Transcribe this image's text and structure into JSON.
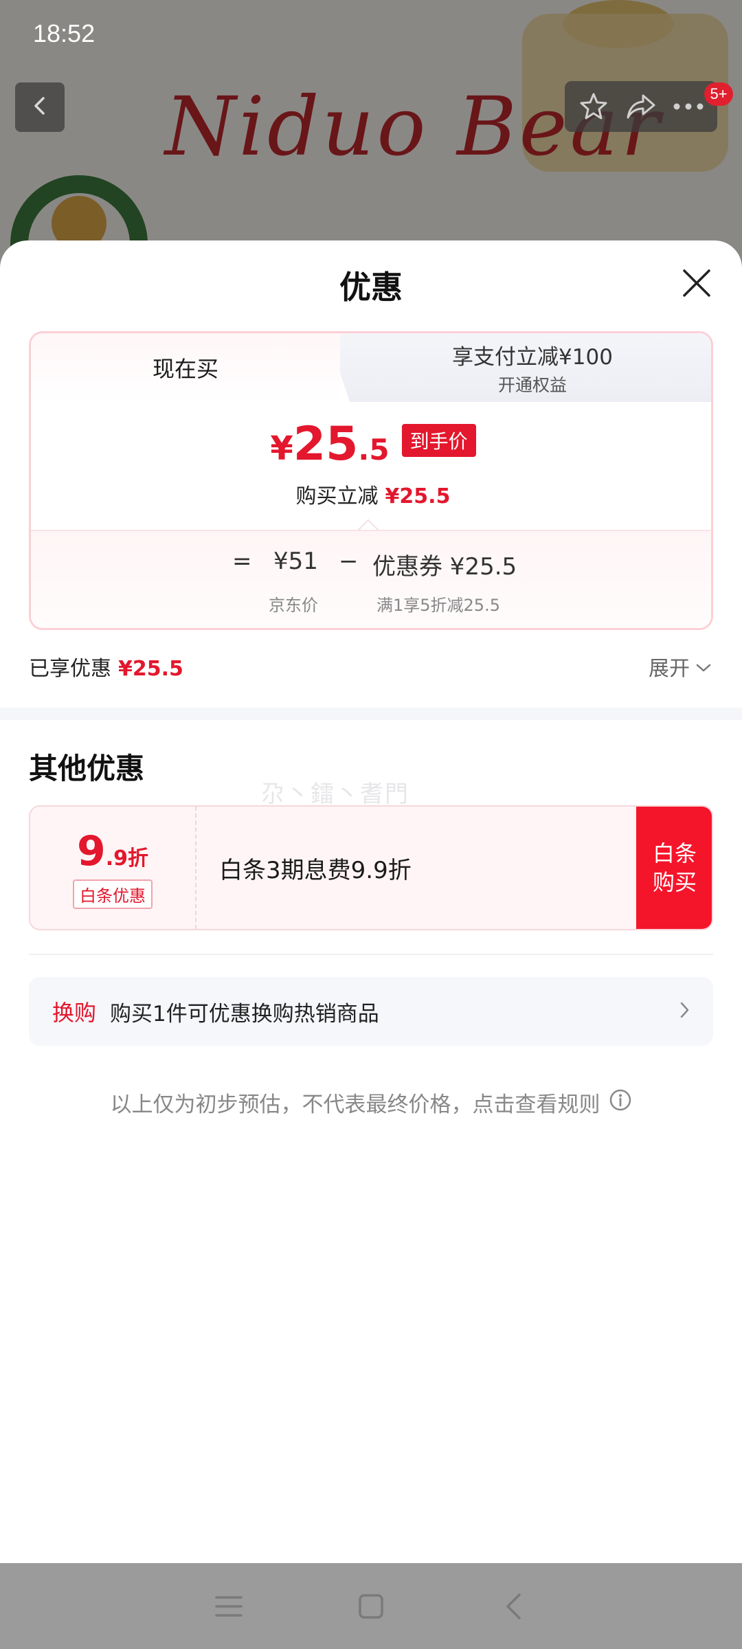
{
  "status_bar": {
    "time": "18:52"
  },
  "background": {
    "banner_title": "Niduo Bear"
  },
  "top_nav": {
    "badge": "5+"
  },
  "sheet": {
    "title": "优惠",
    "tabs": {
      "now": {
        "label": "现在买"
      },
      "pay": {
        "label": "享支付立减¥100",
        "sub": "开通权益"
      }
    },
    "price": {
      "currency": "¥",
      "integer": "25",
      "decimal": ".5",
      "tag": "到手价",
      "reduce_label": "购买立减",
      "reduce_amount": "¥25.5"
    },
    "formula": {
      "equals": "=",
      "jd_price": "¥51",
      "minus": "−",
      "coupon": "优惠券 ¥25.5",
      "jd_caption": "京东价",
      "coupon_caption": "满1享5折减25.5"
    },
    "enjoyed": {
      "label": "已享优惠",
      "amount": "¥25.5"
    },
    "expand_label": "展开",
    "other_title": "其他优惠",
    "watermark": "尕丶鐳丶耆門",
    "promo": {
      "discount_int": "9",
      "discount_dec": ".9折",
      "tag": "白条优惠",
      "text": "白条3期息费9.9折",
      "button_line1": "白条",
      "button_line2": "购买"
    },
    "exchange": {
      "label": "换购",
      "text": "购买1件可优惠换购热销商品"
    },
    "disclaimer": "以上仅为初步预估，不代表最终价格，点击查看规则"
  },
  "colors": {
    "accent": "#e3172d",
    "button": "#f5152b",
    "card_border": "#fbd0d6"
  },
  "icons": [
    "back-icon",
    "star-icon",
    "share-icon",
    "more-icon",
    "close-icon",
    "chevron-down-icon",
    "chevron-right-icon",
    "info-icon",
    "menu-icon",
    "home-icon",
    "system-back-icon"
  ]
}
